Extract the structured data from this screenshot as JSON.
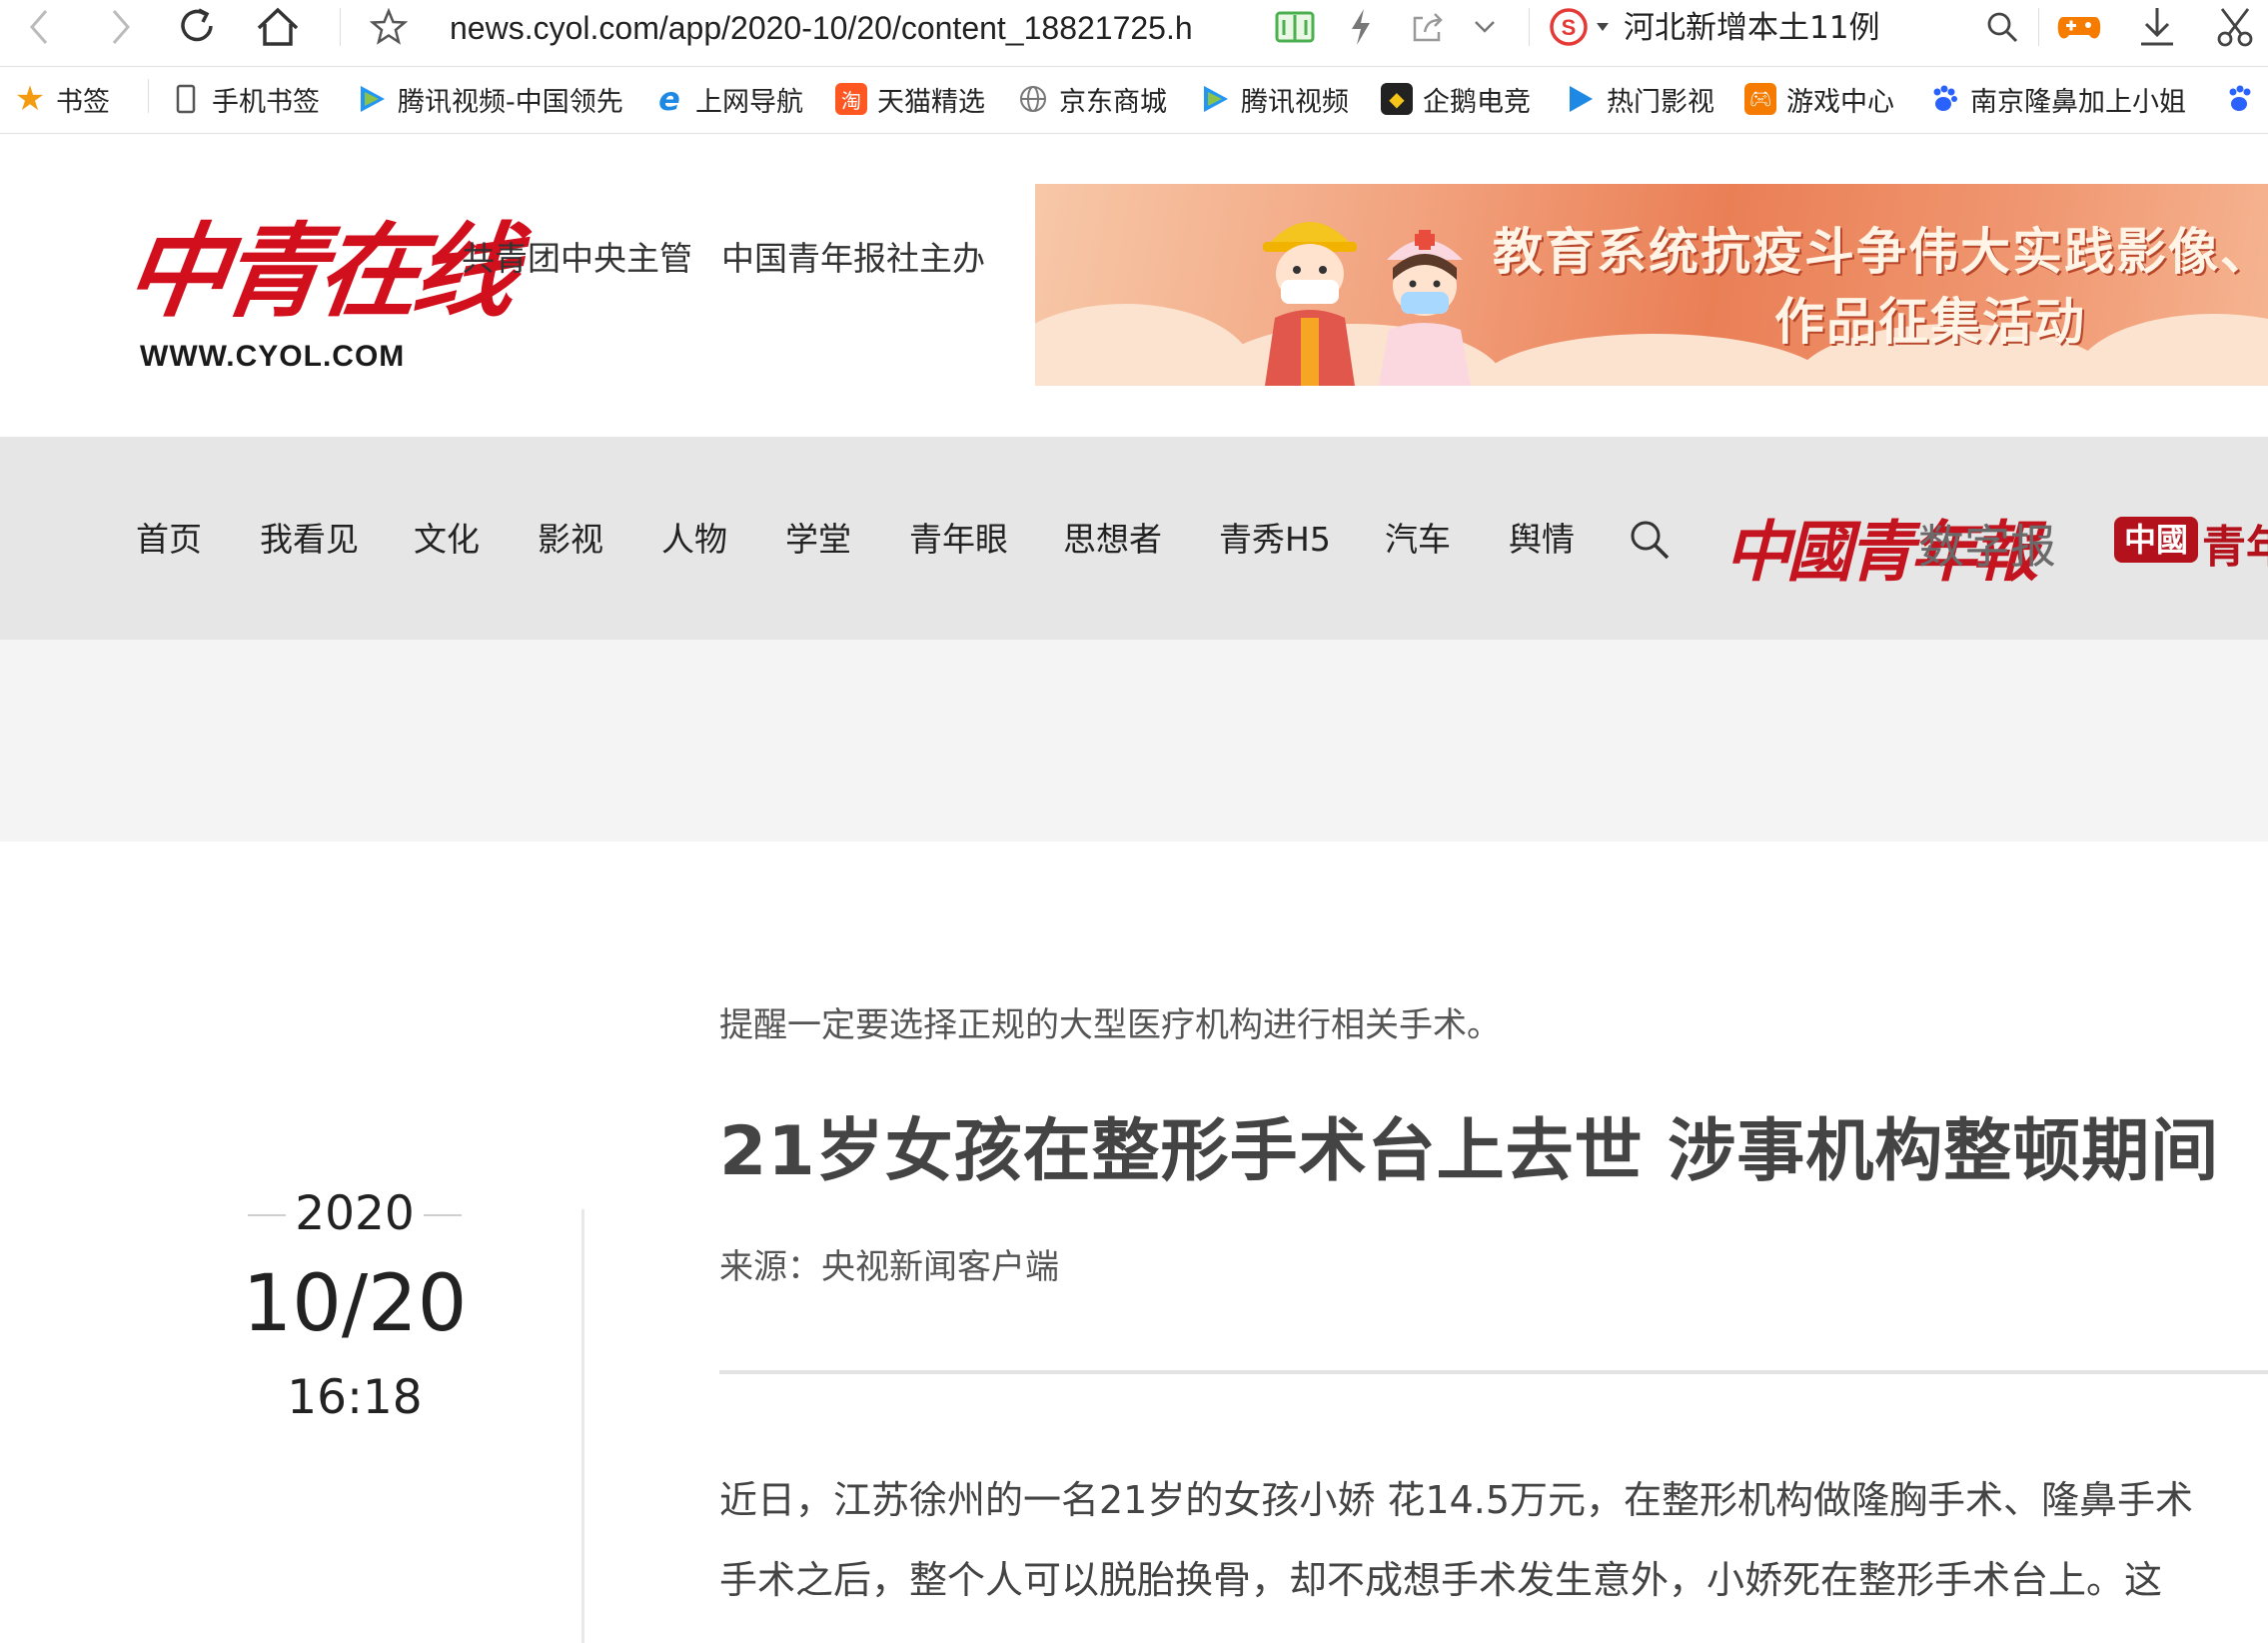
{
  "browser": {
    "url": "news.cyol.com/app/2020-10/20/content_18821725.h",
    "search_engine_text": "河北新增本土11例"
  },
  "bookmarks": [
    {
      "label": "书签",
      "icon": "star-icon",
      "color": "#f39c12"
    },
    {
      "label": "手机书签",
      "icon": "phone-icon",
      "color": "#555555"
    },
    {
      "label": "腾讯视频-中国领先",
      "icon": "tencent-video-icon",
      "color": "#2ecc71"
    },
    {
      "label": "上网导航",
      "icon": "ie-icon",
      "color": "#1e88e5"
    },
    {
      "label": "天猫精选",
      "icon": "tmall-icon",
      "color": "#ff5722"
    },
    {
      "label": "京东商城",
      "icon": "globe-icon",
      "color": "#777777"
    },
    {
      "label": "腾讯视频",
      "icon": "tencent-video-icon",
      "color": "#2ecc71"
    },
    {
      "label": "企鹅电竞",
      "icon": "penguin-esports-icon",
      "color": "#222222"
    },
    {
      "label": "热门影视",
      "icon": "play-icon",
      "color": "#1e88e5"
    },
    {
      "label": "游戏中心",
      "icon": "gamepad-icon",
      "color": "#f57c00"
    },
    {
      "label": "南京隆鼻加上小姐",
      "icon": "baidu-paw-icon",
      "color": "#2962ff"
    }
  ],
  "header": {
    "logo_cn": "中青在线",
    "logo_en": "WWW.CYOL.COM",
    "sponsor_1": "共青团中央主管",
    "sponsor_2": "中国青年报社主办",
    "banner_title": "教育系统抗疫斗争伟大实践影像、海报",
    "banner_sub": "作品征集活动"
  },
  "nav": {
    "items": [
      "首页",
      "我看见",
      "文化",
      "影视",
      "人物",
      "学堂",
      "青年眼",
      "思想者",
      "青秀H5",
      "汽车",
      "舆情"
    ],
    "paper_logo": "中國青年報",
    "paper_label": "数字报",
    "youth_badge": "中國",
    "youth_text": "青年"
  },
  "article": {
    "year": "2020",
    "month_day": "10/20",
    "time": "16:18",
    "summary": "提醒一定要选择正规的大型医疗机构进行相关手术。",
    "headline": "21岁女孩在整形手术台上去世 涉事机构整顿期间",
    "source": "来源：央视新闻客户端",
    "paragraphs": [
      "近日，江苏徐州的一名21岁的女孩小娇 花14.5万元，在整形机构做隆胸手术、隆鼻手术",
      "手术之后，整个人可以脱胎换骨，却不成想手术发生意外，小娇死在整形手术台上。这"
    ]
  }
}
